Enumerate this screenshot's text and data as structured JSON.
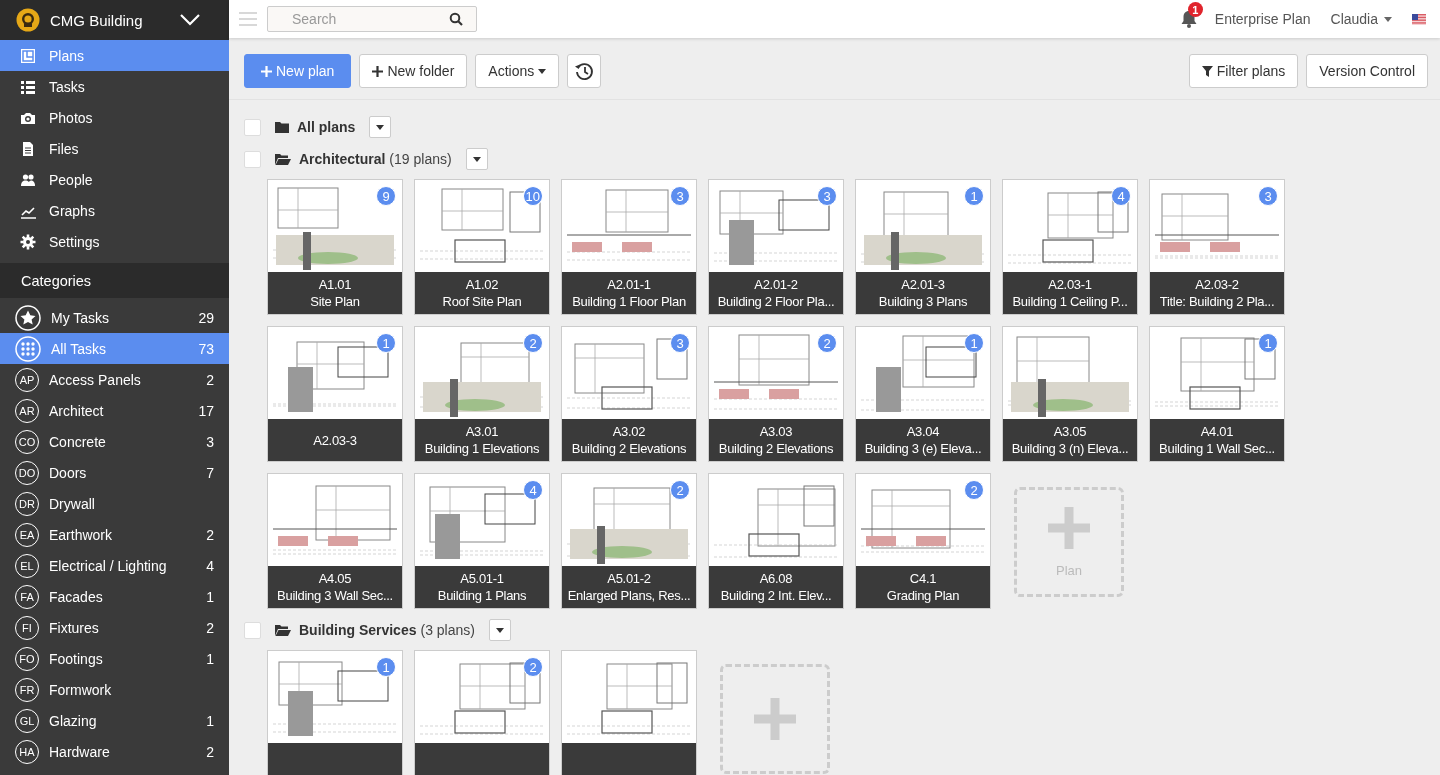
{
  "project": {
    "name": "CMG Building"
  },
  "nav": [
    {
      "label": "Plans",
      "kind": "plans",
      "selected": true
    },
    {
      "label": "Tasks",
      "kind": "tasks",
      "selected": false
    },
    {
      "label": "Photos",
      "kind": "photos",
      "selected": false
    },
    {
      "label": "Files",
      "kind": "files",
      "selected": false
    },
    {
      "label": "People",
      "kind": "people",
      "selected": false
    },
    {
      "label": "Graphs",
      "kind": "graphs",
      "selected": false
    },
    {
      "label": "Settings",
      "kind": "settings",
      "selected": false
    }
  ],
  "categories_heading": "Categories",
  "categories": [
    {
      "kind": "star",
      "label": "My Tasks",
      "count": "29",
      "selected": false
    },
    {
      "kind": "grid",
      "label": "All Tasks",
      "count": "73",
      "selected": true
    },
    {
      "kind": "initials",
      "initials": "AP",
      "label": "Access Panels",
      "count": "2",
      "selected": false
    },
    {
      "kind": "initials",
      "initials": "AR",
      "label": "Architect",
      "count": "17",
      "selected": false
    },
    {
      "kind": "initials",
      "initials": "CO",
      "label": "Concrete",
      "count": "3",
      "selected": false
    },
    {
      "kind": "initials",
      "initials": "DO",
      "label": "Doors",
      "count": "7",
      "selected": false
    },
    {
      "kind": "initials",
      "initials": "DR",
      "label": "Drywall",
      "selected": false
    },
    {
      "kind": "initials",
      "initials": "EA",
      "label": "Earthwork",
      "count": "2",
      "selected": false
    },
    {
      "kind": "initials",
      "initials": "EL",
      "label": "Electrical / Lighting",
      "count": "4",
      "selected": false
    },
    {
      "kind": "initials",
      "initials": "FA",
      "label": "Facades",
      "count": "1",
      "selected": false
    },
    {
      "kind": "initials",
      "initials": "FI",
      "label": "Fixtures",
      "count": "2",
      "selected": false
    },
    {
      "kind": "initials",
      "initials": "FO",
      "label": "Footings",
      "count": "1",
      "selected": false
    },
    {
      "kind": "initials",
      "initials": "FR",
      "label": "Formwork",
      "selected": false
    },
    {
      "kind": "initials",
      "initials": "GL",
      "label": "Glazing",
      "count": "1",
      "selected": false
    },
    {
      "kind": "initials",
      "initials": "HA",
      "label": "Hardware",
      "count": "2",
      "selected": false
    }
  ],
  "topbar": {
    "search_placeholder": "Search",
    "notification_count": "1",
    "plan": "Enterprise Plan",
    "user": "Claudia"
  },
  "toolbar": {
    "left": [
      {
        "kind": "primary",
        "label": "New plan"
      },
      {
        "kind": "add",
        "label": "New folder"
      },
      {
        "kind": "dropdown",
        "label": "Actions"
      },
      {
        "kind": "history"
      }
    ],
    "right": [
      {
        "kind": "filter",
        "label": "Filter plans"
      },
      {
        "kind": "plain",
        "label": "Version Control"
      }
    ]
  },
  "all_plans": {
    "label": "All plans",
    "checked": false
  },
  "folders": [
    {
      "name": "Architectural",
      "count": "(19 plans)",
      "checked": false,
      "add_label": "Plan",
      "plans": [
        {
          "code": "A1.01",
          "title": "Site Plan",
          "badge": "9"
        },
        {
          "code": "A1.02",
          "title": "Roof Site Plan",
          "badge": "10"
        },
        {
          "code": "A2.01-1",
          "title": "Building 1 Floor Plan",
          "badge": "3"
        },
        {
          "code": "A2.01-2",
          "title": "Building 2 Floor Pla...",
          "badge": "3"
        },
        {
          "code": "A2.01-3",
          "title": "Building 3 Plans",
          "badge": "1"
        },
        {
          "code": "A2.03-1",
          "title": "Building 1 Ceiling P...",
          "badge": "4"
        },
        {
          "code": "A2.03-2",
          "title": "Title: Building 2 Pla...",
          "badge": "3"
        },
        {
          "code": "A2.03-3",
          "badge": "1"
        },
        {
          "code": "A3.01",
          "title": "Building 1 Elevations",
          "badge": "2"
        },
        {
          "code": "A3.02",
          "title": "Building 2 Elevations",
          "badge": "3"
        },
        {
          "code": "A3.03",
          "title": "Building 2 Elevations",
          "badge": "2"
        },
        {
          "code": "A3.04",
          "title": "Building 3 (e) Eleva...",
          "badge": "1"
        },
        {
          "code": "A3.05",
          "title": "Building 3 (n) Eleva..."
        },
        {
          "code": "A4.01",
          "title": "Building 1 Wall Sec...",
          "badge": "1"
        },
        {
          "code": "A4.05",
          "title": "Building 3 Wall Sec..."
        },
        {
          "code": "A5.01-1",
          "title": "Building 1 Plans",
          "badge": "4"
        },
        {
          "code": "A5.01-2",
          "title": "Enlarged Plans, Res...",
          "badge": "2"
        },
        {
          "code": "A6.08",
          "title": "Building 2 Int. Elev..."
        },
        {
          "code": "C4.1",
          "title": "Grading Plan",
          "badge": "2"
        }
      ]
    },
    {
      "name": "Building Services",
      "count": "(3 plans)",
      "checked": false,
      "plans": [
        {
          "kind": "site",
          "badge": "1"
        },
        {
          "kind": "floor",
          "badge": "2"
        },
        {
          "kind": "floor"
        }
      ]
    }
  ]
}
